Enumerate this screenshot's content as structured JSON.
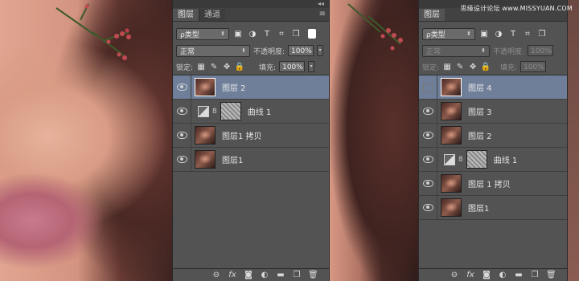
{
  "watermark": "思缘设计论坛 www.MISSYUAN.COM",
  "panels": [
    {
      "tabs": [
        "图层",
        "通道"
      ],
      "filter_label": "ρ类型",
      "filter_icons": [
        "pixel-filter-icon",
        "adjustment-filter-icon",
        "type-filter-icon",
        "shape-filter-icon",
        "smart-object-filter-icon"
      ],
      "blend_mode": "正常",
      "opacity_label": "不透明度:",
      "opacity_value": "100%",
      "lock_label": "锁定:",
      "fill_label": "填充:",
      "fill_value": "100%",
      "layers": [
        {
          "name": "图层 2",
          "type": "pixel",
          "selected": true,
          "visible": true
        },
        {
          "name": "曲线 1",
          "type": "adjustment",
          "selected": false,
          "visible": true
        },
        {
          "name": "图层1 拷贝",
          "type": "pixel",
          "selected": false,
          "visible": true
        },
        {
          "name": "图层1",
          "type": "pixel",
          "selected": false,
          "visible": true
        }
      ]
    },
    {
      "tabs": [
        "图层"
      ],
      "filter_label": "ρ类型",
      "filter_icons": [
        "pixel-filter-icon",
        "adjustment-filter-icon",
        "type-filter-icon",
        "shape-filter-icon",
        "smart-object-filter-icon"
      ],
      "blend_mode": "正常",
      "opacity_label": "不透明度:",
      "opacity_value": "100%",
      "lock_label": "锁定:",
      "fill_label": "填充:",
      "fill_value": "100%",
      "layers": [
        {
          "name": "图层 4",
          "type": "pixel",
          "selected": true,
          "visible": false
        },
        {
          "name": "图层 3",
          "type": "pixel",
          "selected": false,
          "visible": true
        },
        {
          "name": "图层 2",
          "type": "pixel",
          "selected": false,
          "visible": true
        },
        {
          "name": "曲线 1",
          "type": "adjustment",
          "selected": false,
          "visible": true
        },
        {
          "name": "图层 1 拷贝",
          "type": "pixel",
          "selected": false,
          "visible": true
        },
        {
          "name": "图层1",
          "type": "pixel",
          "selected": false,
          "visible": true
        }
      ]
    }
  ],
  "bottom_icons": [
    "link-layers-icon",
    "fx-icon",
    "add-mask-icon",
    "new-adjustment-icon",
    "new-group-icon",
    "new-layer-icon",
    "delete-layer-icon"
  ],
  "colors": {
    "panel_bg": "#535353",
    "selected_layer": "#6f7f9a"
  }
}
